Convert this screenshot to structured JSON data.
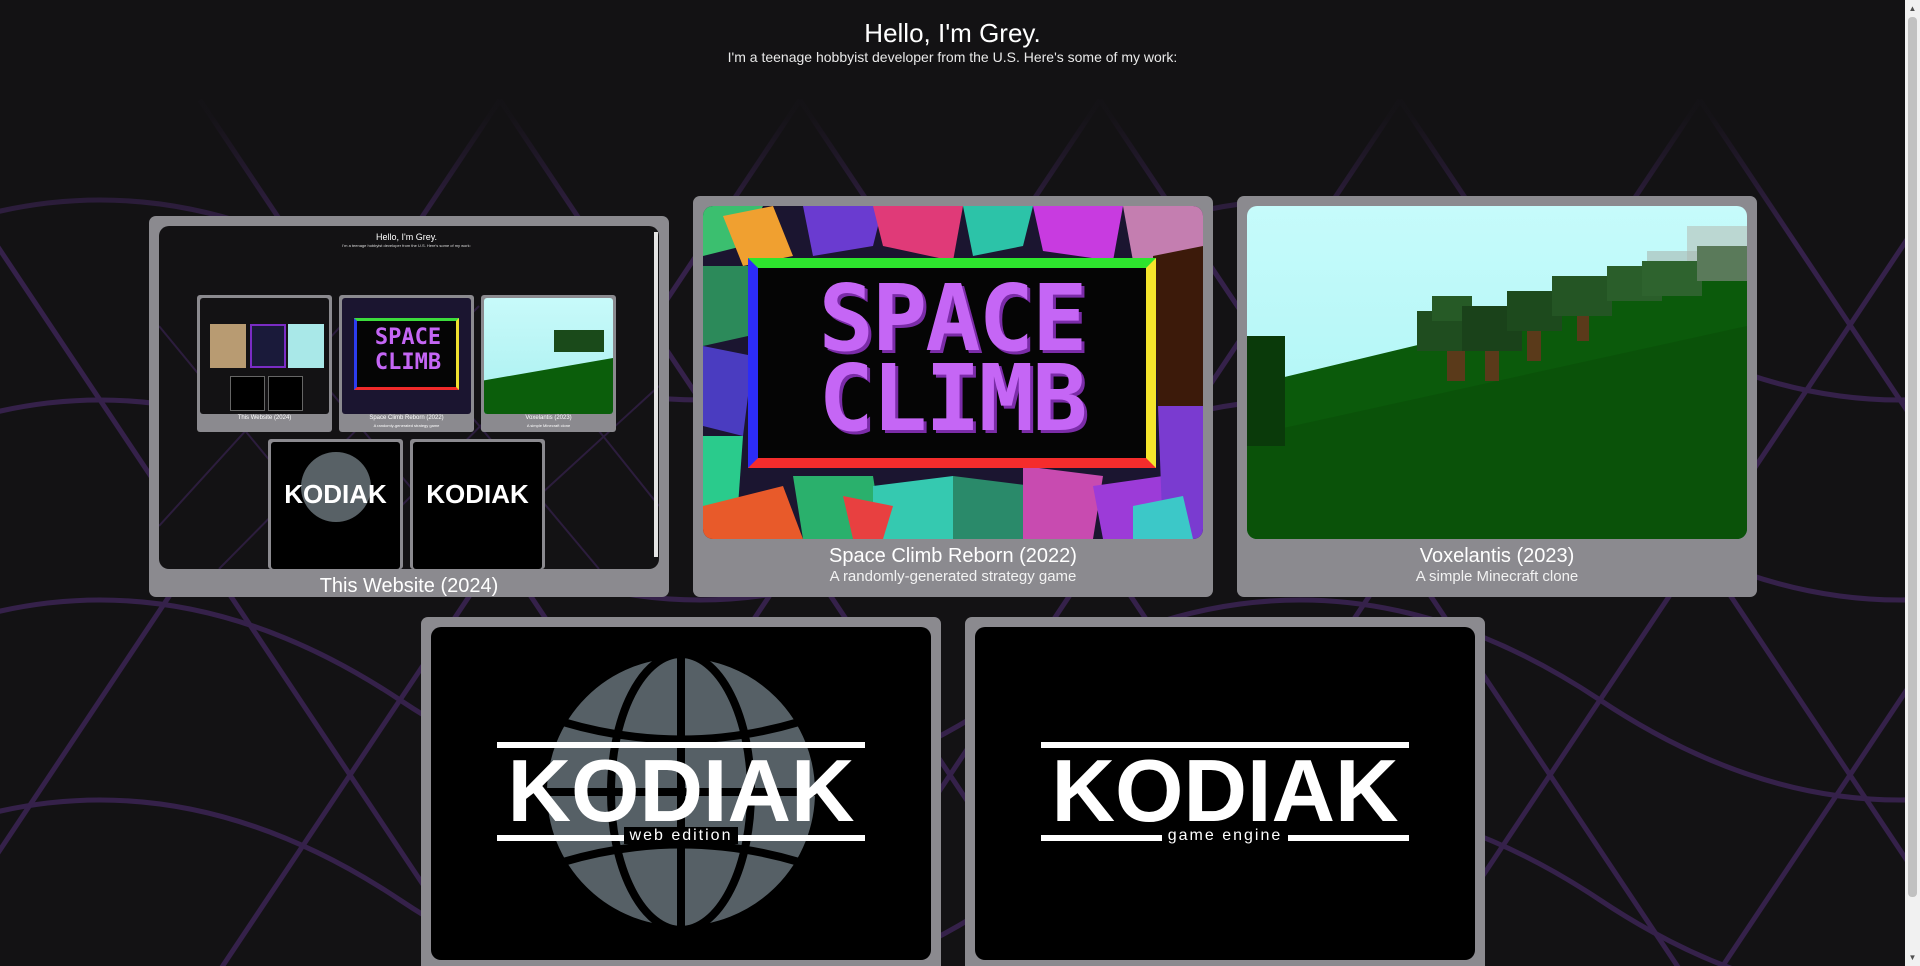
{
  "header": {
    "title": "Hello, I'm Grey.",
    "subtitle": "I'm a teenage hobbyist developer from the U.S. Here's some of my work:"
  },
  "projects": [
    {
      "title": "This Website (2024)",
      "description": ""
    },
    {
      "title": "Space Climb Reborn (2022)",
      "description": "A randomly-generated strategy game"
    },
    {
      "title": "Voxelantis (2023)",
      "description": "A simple Minecraft clone"
    },
    {
      "title": "",
      "description": ""
    },
    {
      "title": "",
      "description": ""
    }
  ],
  "logos": {
    "space_climb_line1": "SPACE",
    "space_climb_line2": "CLIMB",
    "kodiak": "KODIAK",
    "kodiak_web_sub": "web edition",
    "kodiak_engine_sub": "game engine"
  },
  "icons": {
    "scroll_up": "arrow-up-icon",
    "scroll_down": "arrow-down-icon"
  },
  "colors": {
    "background": "#131214",
    "card": "#8b8a8f",
    "grid_line": "#3a2450",
    "space_climb_purple": "#b64df4"
  }
}
